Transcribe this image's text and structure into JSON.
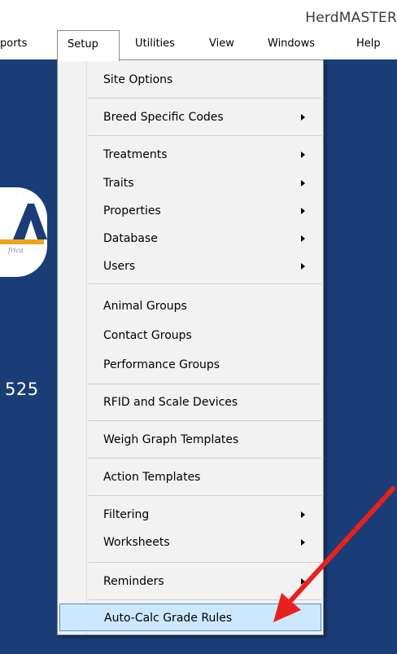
{
  "titlebar": {
    "app_title": "HerdMASTER"
  },
  "menubar": {
    "items": [
      {
        "label": "ports"
      },
      {
        "label": "Setup"
      },
      {
        "label": "Utilities"
      },
      {
        "label": "View"
      },
      {
        "label": "Windows"
      },
      {
        "label": "Help"
      }
    ]
  },
  "background": {
    "partial_number": "525"
  },
  "setup_menu": {
    "items": [
      {
        "label": "Site Options"
      },
      {
        "label": "Breed Specific Codes"
      },
      {
        "label": "Treatments"
      },
      {
        "label": "Traits"
      },
      {
        "label": "Properties"
      },
      {
        "label": "Database"
      },
      {
        "label": "Users"
      },
      {
        "label": "Animal Groups"
      },
      {
        "label": "Contact Groups"
      },
      {
        "label": "Performance Groups"
      },
      {
        "label": "RFID and Scale Devices"
      },
      {
        "label": "Weigh Graph Templates"
      },
      {
        "label": "Action Templates"
      },
      {
        "label": "Filtering"
      },
      {
        "label": "Worksheets"
      },
      {
        "label": "Reminders"
      },
      {
        "label": "Auto-Calc Grade Rules"
      }
    ]
  },
  "colors": {
    "workspace_bg": "#1a3d77",
    "menu_bg": "#f2f2f2",
    "highlight_bg": "#cce8ff",
    "highlight_border": "#4a90c8",
    "annotation_arrow": "#e8211f",
    "logo_accent": "#f0a21a"
  }
}
